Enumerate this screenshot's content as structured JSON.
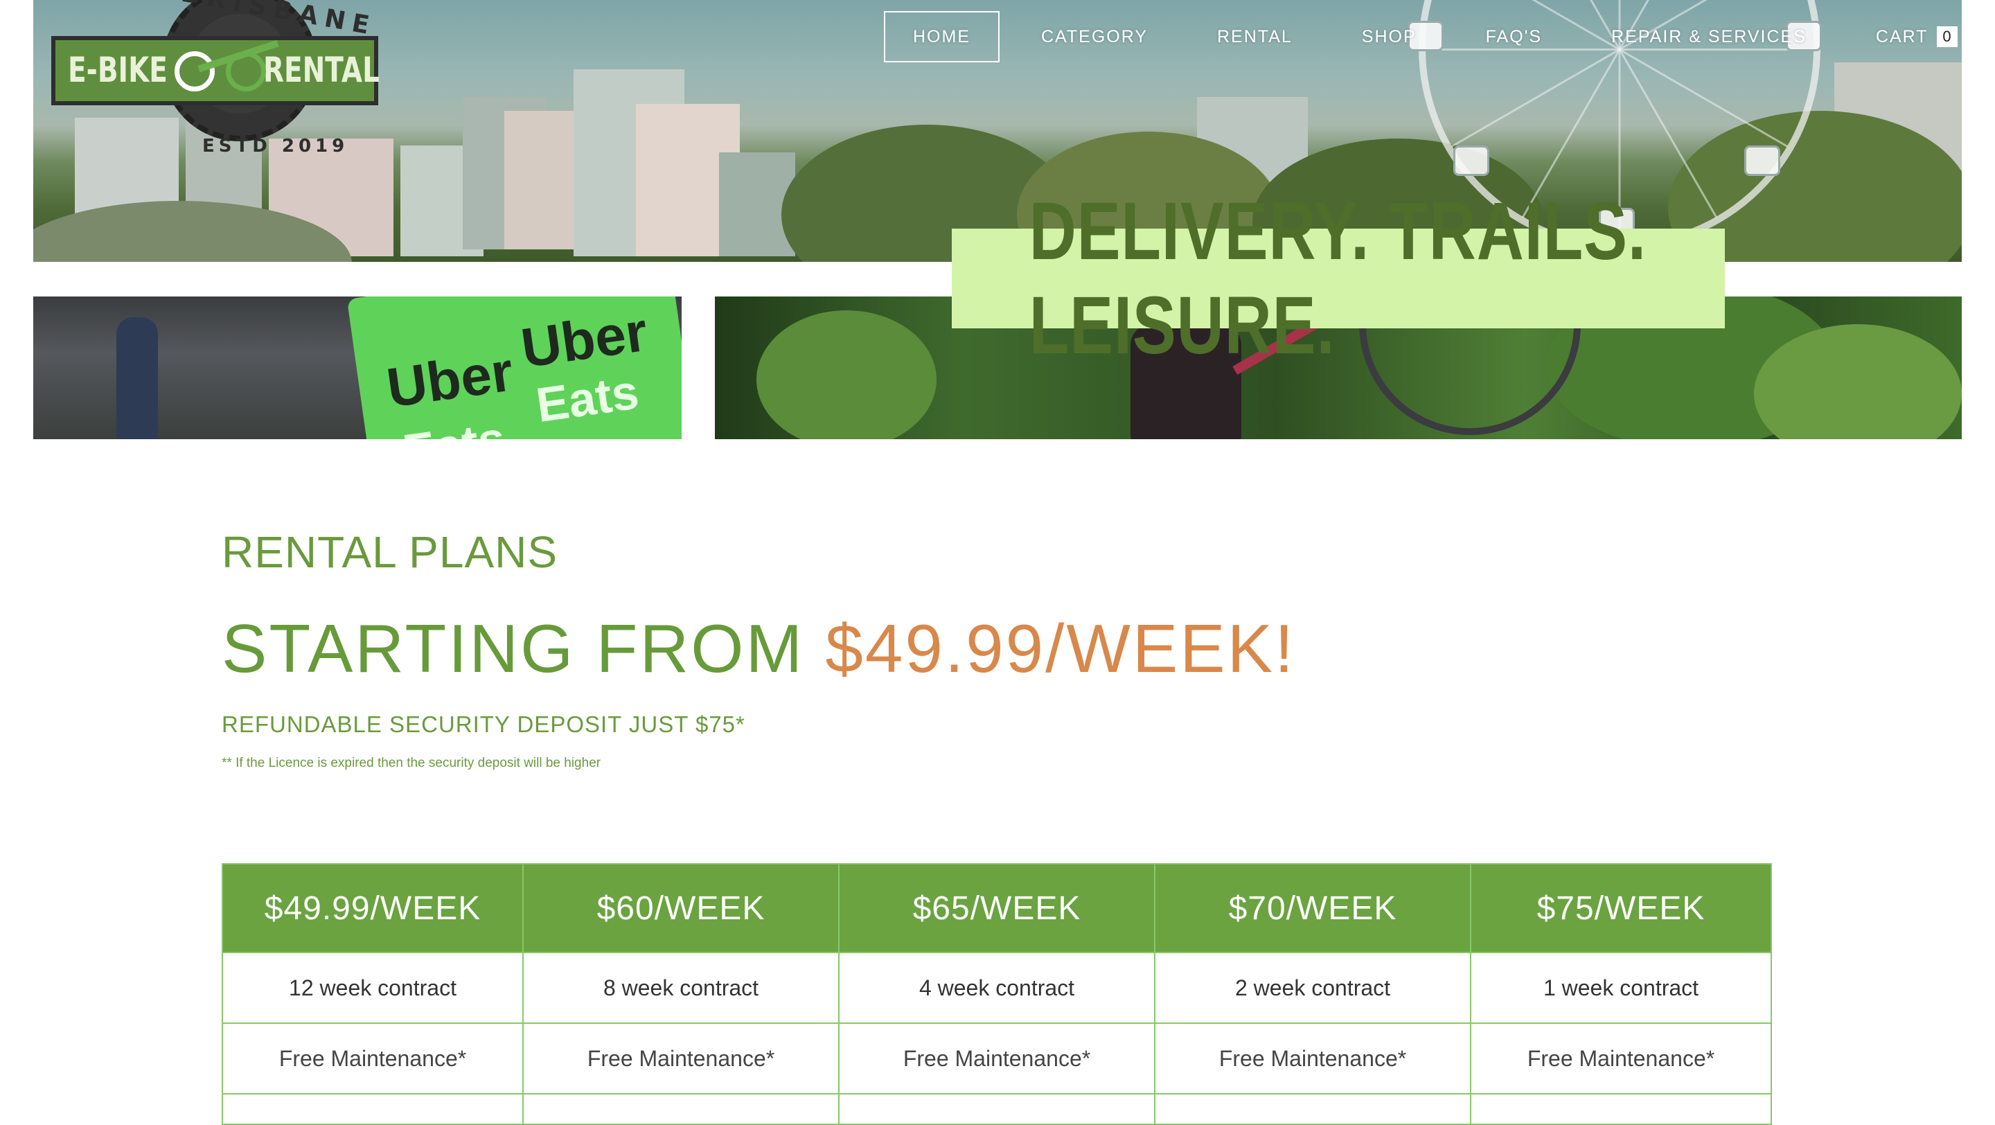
{
  "logo": {
    "arc_text": "BRISBANE",
    "left_word": "E-BIKE",
    "right_word": "RENTAL",
    "established": "ESTD 2019"
  },
  "nav": {
    "items": [
      {
        "label": "HOME",
        "active": true
      },
      {
        "label": "CATEGORY"
      },
      {
        "label": "RENTAL"
      },
      {
        "label": "SHOP"
      },
      {
        "label": "FAQ'S"
      },
      {
        "label": "REPAIR & SERVICES"
      }
    ],
    "cart_label": "CART",
    "cart_count": "0"
  },
  "hero": {
    "tagline": "DELIVERY. TRAILS. LEISURE.",
    "bag_brand_top": "Uber",
    "bag_brand_bottom": "Eats"
  },
  "section": {
    "title": "RENTAL PLANS",
    "headline_prefix": "STARTING FROM",
    "headline_price": "$49.99/WEEK!",
    "deposit": "REFUNDABLE SECURITY DEPOSIT JUST $75*",
    "note": "** If the Licence is expired then the security deposit will be higher"
  },
  "plans": {
    "headers": [
      "$49.99/WEEK",
      "$60/WEEK",
      "$65/WEEK",
      "$70/WEEK",
      "$75/WEEK"
    ],
    "contracts": [
      "12 week contract",
      "8 week contract",
      "4 week contract",
      "2 week contract",
      "1 week contract"
    ],
    "maintenance": [
      "Free Maintenance*",
      "Free Maintenance*",
      "Free Maintenance*",
      "Free Maintenance*",
      "Free Maintenance*"
    ]
  },
  "colors": {
    "brand_green": "#6aa340",
    "accent_orange": "#d8884a",
    "tagline_bg": "#d3f3a8"
  }
}
